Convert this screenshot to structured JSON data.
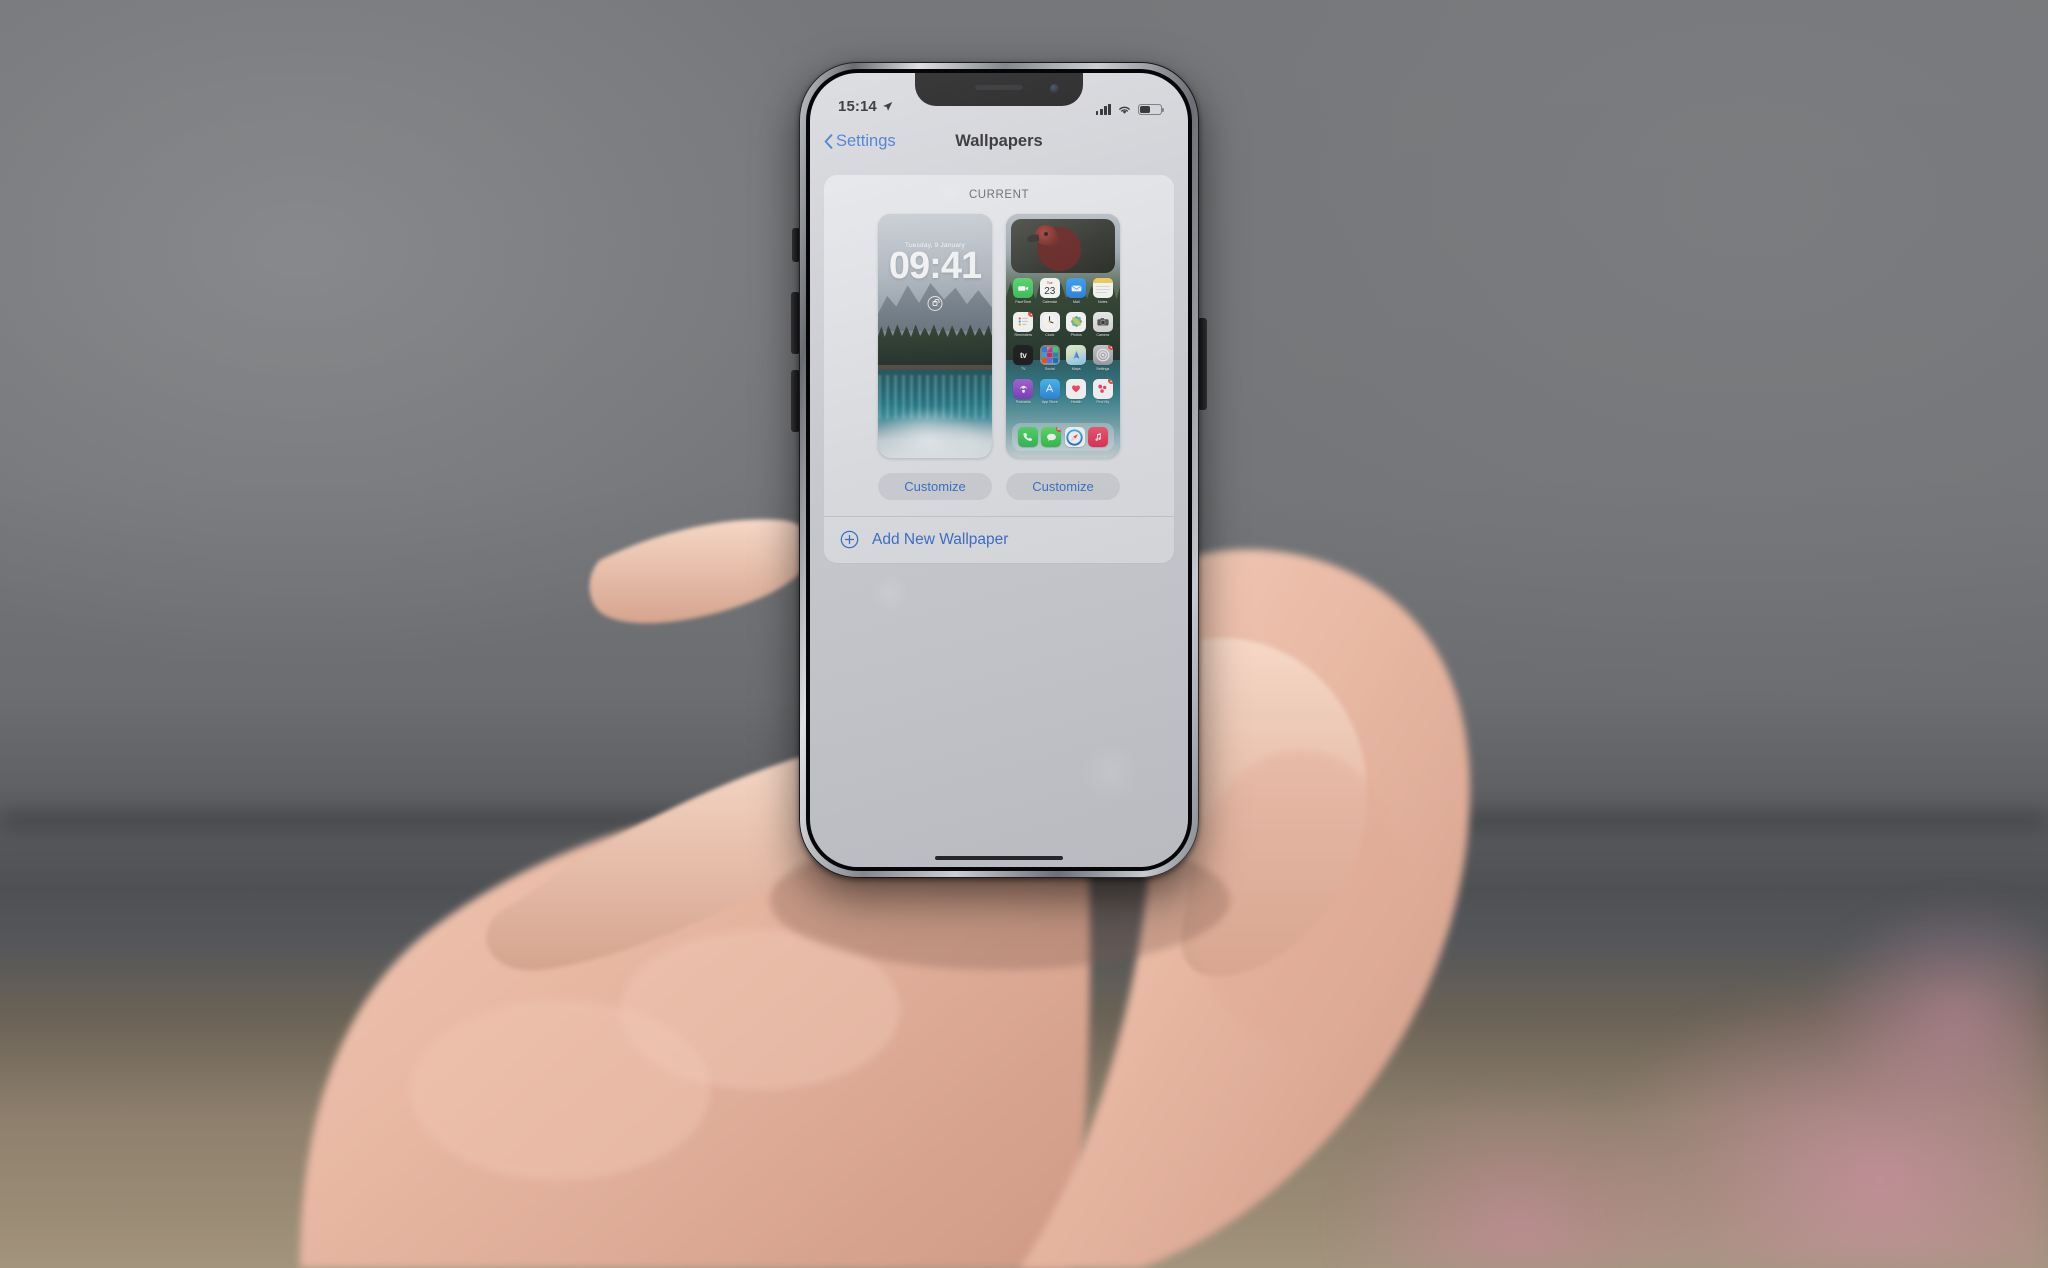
{
  "statusbar": {
    "time": "15:14",
    "location_icon": "location-arrow-icon",
    "signal_icon": "cellular-signal-icon",
    "wifi_icon": "wifi-icon",
    "battery_icon": "battery-icon",
    "battery_level_percent": 45
  },
  "navbar": {
    "back_label": "Settings",
    "back_chevron_icon": "chevron-left-icon",
    "title": "Wallpapers"
  },
  "content": {
    "section_title": "CURRENT",
    "lock_screen_preview": {
      "date": "Tuesday, 9 January",
      "time": "09:41",
      "lock_icon": "lock-icon",
      "wallpaper_description": "mountain lake with forest reflection"
    },
    "home_screen_preview": {
      "widget_description": "bird photo widget",
      "apps": [
        {
          "label": "FaceTime",
          "icon": "facetime-icon",
          "badge": ""
        },
        {
          "label": "Calendar",
          "icon": "calendar-icon",
          "badge": "",
          "day": "23",
          "weekday": "Tue"
        },
        {
          "label": "Mail",
          "icon": "mail-icon",
          "badge": ""
        },
        {
          "label": "Notes",
          "icon": "notes-icon",
          "badge": ""
        },
        {
          "label": "Reminders",
          "icon": "reminders-icon",
          "badge": "2"
        },
        {
          "label": "Clock",
          "icon": "clock-icon",
          "badge": ""
        },
        {
          "label": "Photos",
          "icon": "photos-icon",
          "badge": ""
        },
        {
          "label": "Camera",
          "icon": "camera-icon",
          "badge": ""
        },
        {
          "label": "TV",
          "icon": "tv-icon",
          "badge": ""
        },
        {
          "label": "Social",
          "icon": "folder-icon",
          "badge": ""
        },
        {
          "label": "Maps",
          "icon": "maps-icon",
          "badge": ""
        },
        {
          "label": "Settings",
          "icon": "settings-icon",
          "badge": "1"
        },
        {
          "label": "Podcasts",
          "icon": "podcasts-icon",
          "badge": ""
        },
        {
          "label": "App Store",
          "icon": "appstore-icon",
          "badge": ""
        },
        {
          "label": "Health",
          "icon": "health-icon",
          "badge": ""
        },
        {
          "label": "Find My",
          "icon": "findmy-icon",
          "badge": "2"
        }
      ],
      "dock": [
        {
          "label": "Phone",
          "icon": "phone-icon",
          "badge": ""
        },
        {
          "label": "Messages",
          "icon": "messages-icon",
          "badge": "64"
        },
        {
          "label": "Safari",
          "icon": "safari-icon",
          "badge": ""
        },
        {
          "label": "Music",
          "icon": "music-icon",
          "badge": ""
        }
      ]
    },
    "customize_lock_label": "Customize",
    "customize_home_label": "Customize",
    "add_wallpaper": {
      "label": "Add New Wallpaper",
      "icon": "plus-circle-icon"
    }
  },
  "colors": {
    "accent_blue": "#2f6dd0",
    "screen_bg": "#d4d5da",
    "card_bg": "#fcfcfd",
    "badge_red": "#f63e33"
  }
}
